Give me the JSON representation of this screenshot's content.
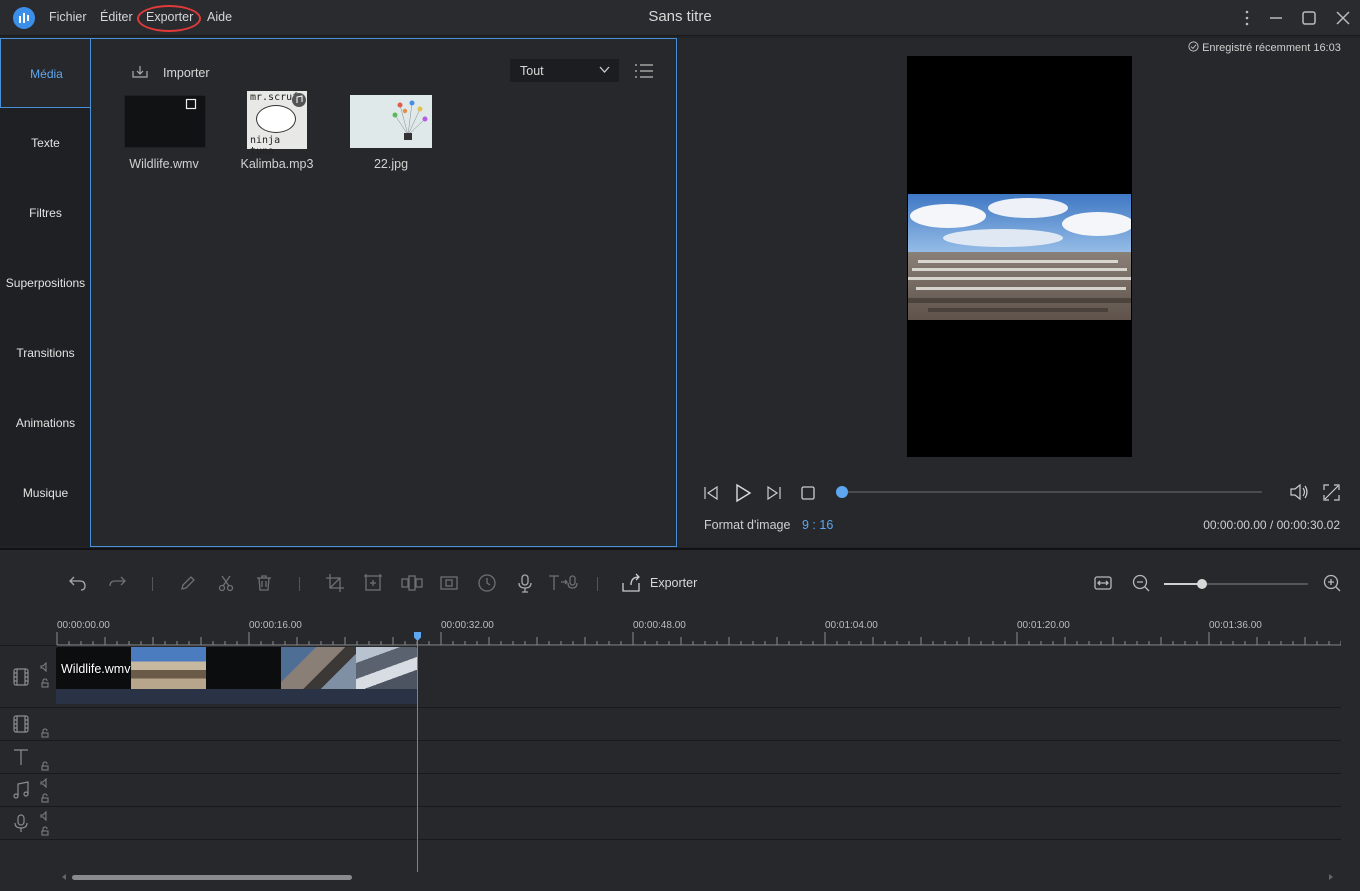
{
  "window": {
    "title": "Sans titre"
  },
  "menu": [
    "Fichier",
    "Éditer",
    "Exporter",
    "Aide"
  ],
  "sidebar": {
    "tabs": [
      "Média",
      "Texte",
      "Filtres",
      "Superpositions",
      "Transitions",
      "Animations",
      "Musique"
    ],
    "active": "Média"
  },
  "media": {
    "import_label": "Importer",
    "filter_value": "Tout",
    "items": [
      {
        "name": "Wildlife.wmv",
        "type": "video"
      },
      {
        "name": "Kalimba.mp3",
        "type": "audio",
        "art_text_1": "mr.scruf",
        "art_text_2": "ninja tuna"
      },
      {
        "name": "22.jpg",
        "type": "image"
      }
    ]
  },
  "preview": {
    "saved_status": "Enregistré récemment 16:03",
    "aspect_label": "Format d'image",
    "aspect_value": "9 : 16",
    "time_display": "00:00:00.00 / 00:00:30.02",
    "progress": 0
  },
  "timeline": {
    "export_label": "Exporter",
    "ruler_labels": [
      "00:00:00.00",
      "00:00:16.00",
      "00:00:32.00",
      "00:00:48.00",
      "00:01:04.00",
      "00:01:20.00",
      "00:01:36.00"
    ],
    "clip_label": "Wildlife.wmv",
    "playhead_time": "00:00:30.02"
  },
  "colors": {
    "accent": "#4a90d9",
    "export_highlight": "#e03a3a"
  }
}
